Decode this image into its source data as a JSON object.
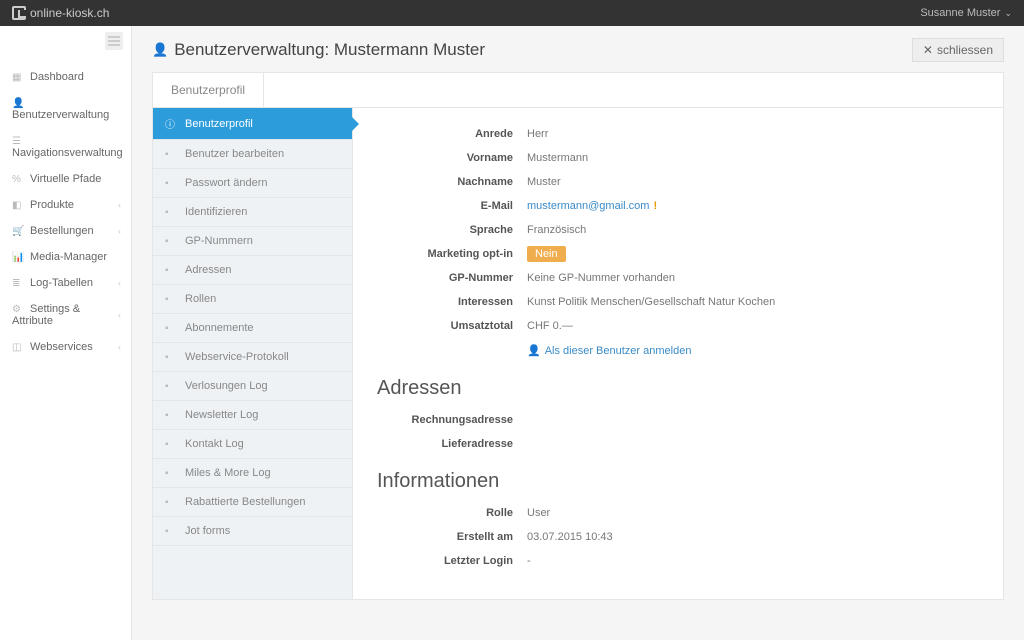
{
  "brand": "online-kiosk.ch",
  "currentUser": "Susanne Muster",
  "pageTitle": "Benutzerverwaltung: Mustermann Muster",
  "closeLabel": "schliessen",
  "mainTab": "Benutzerprofil",
  "nav": [
    {
      "label": "Dashboard",
      "icon": "▦",
      "arrow": false
    },
    {
      "label": "Benutzerverwaltung",
      "icon": "👤",
      "arrow": false
    },
    {
      "label": "Navigationsverwaltung",
      "icon": "☰",
      "arrow": false
    },
    {
      "label": "Virtuelle Pfade",
      "icon": "%",
      "arrow": false
    },
    {
      "label": "Produkte",
      "icon": "◧",
      "arrow": true
    },
    {
      "label": "Bestellungen",
      "icon": "🛒",
      "arrow": true
    },
    {
      "label": "Media-Manager",
      "icon": "📊",
      "arrow": false
    },
    {
      "label": "Log-Tabellen",
      "icon": "≣",
      "arrow": true
    },
    {
      "label": "Settings & Attribute",
      "icon": "⚙",
      "arrow": true
    },
    {
      "label": "Webservices",
      "icon": "◫",
      "arrow": true
    }
  ],
  "submenu": [
    {
      "label": "Benutzerprofil",
      "active": true
    },
    {
      "label": "Benutzer bearbeiten"
    },
    {
      "label": "Passwort ändern"
    },
    {
      "label": "Identifizieren"
    },
    {
      "label": "GP-Nummern"
    },
    {
      "label": "Adressen"
    },
    {
      "label": "Rollen"
    },
    {
      "label": "Abonnemente"
    },
    {
      "label": "Webservice-Protokoll"
    },
    {
      "label": "Verlosungen Log"
    },
    {
      "label": "Newsletter Log"
    },
    {
      "label": "Kontakt Log"
    },
    {
      "label": "Miles & More Log"
    },
    {
      "label": "Rabattierte Bestellungen"
    },
    {
      "label": "Jot forms"
    }
  ],
  "profile": {
    "anredeLabel": "Anrede",
    "anrede": "Herr",
    "vornameLabel": "Vorname",
    "vorname": "Mustermann",
    "nachnameLabel": "Nachname",
    "nachname": "Muster",
    "emailLabel": "E-Mail",
    "email": "mustermann@gmail.com",
    "spracheLabel": "Sprache",
    "sprache": "Französisch",
    "marketingLabel": "Marketing opt-in",
    "marketing": "Nein",
    "gpLabel": "GP-Nummer",
    "gp": "Keine GP-Nummer vorhanden",
    "interessenLabel": "Interessen",
    "interessen": "Kunst   Politik   Menschen/Gesellschaft   Natur   Kochen",
    "umsatzLabel": "Umsatztotal",
    "umsatz": "CHF 0.—",
    "loginAsLabel": "Als dieser Benutzer anmelden"
  },
  "addresses": {
    "title": "Adressen",
    "billingLabel": "Rechnungsadresse",
    "shippingLabel": "Lieferadresse"
  },
  "info": {
    "title": "Informationen",
    "rolleLabel": "Rolle",
    "rolle": "User",
    "erstelltLabel": "Erstellt am",
    "erstellt": "03.07.2015 10:43",
    "loginLabel": "Letzter Login",
    "login": "-"
  }
}
